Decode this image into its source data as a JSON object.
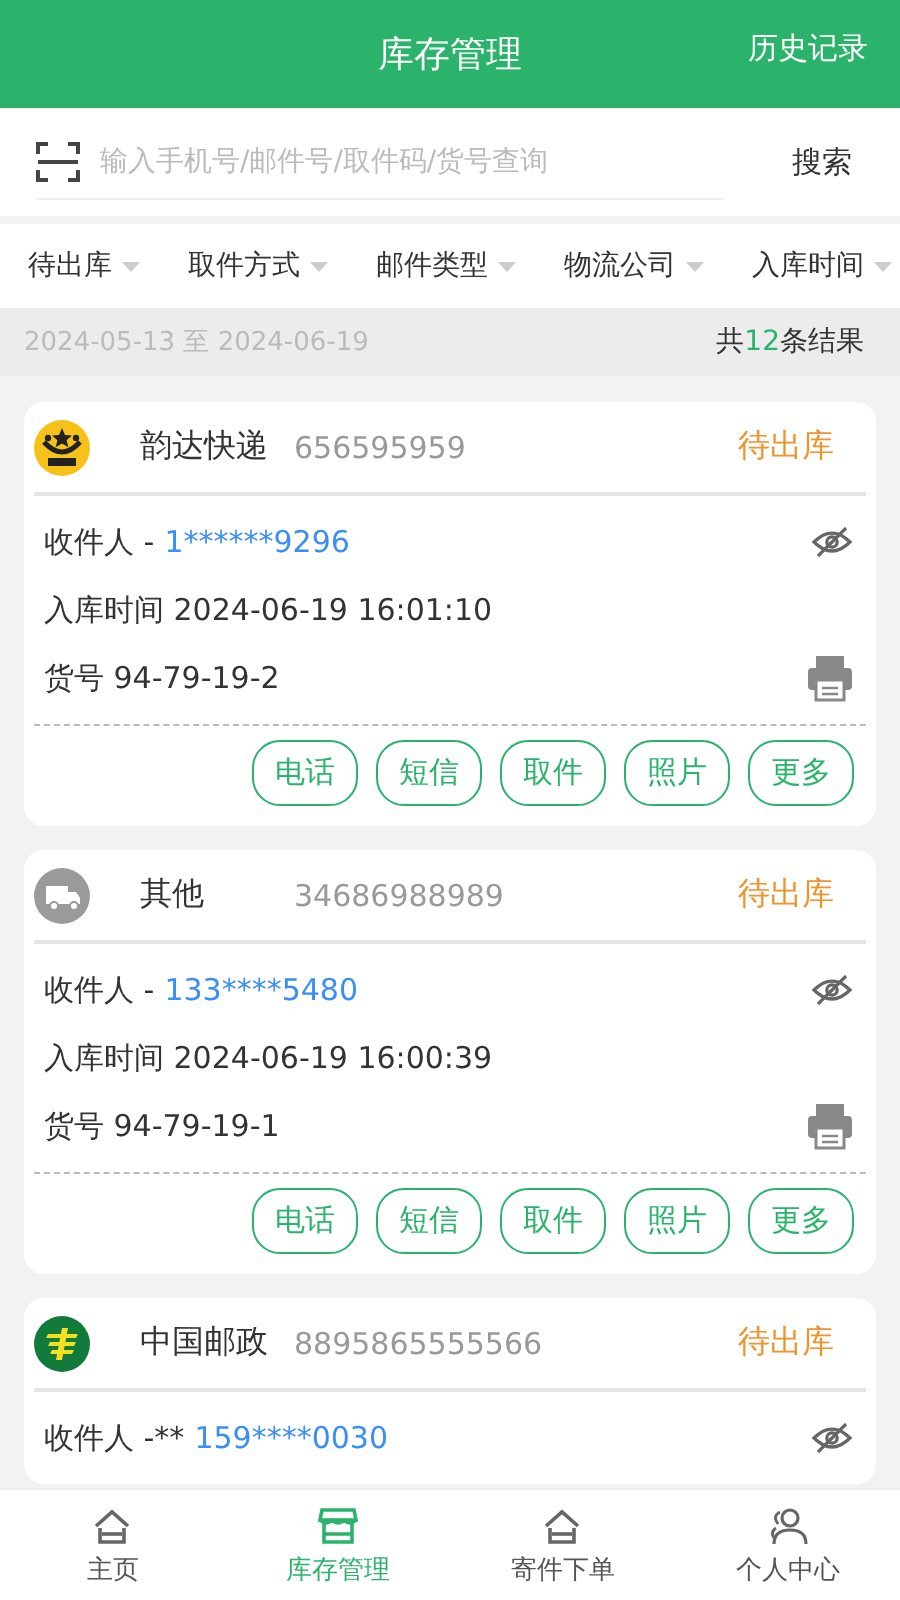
{
  "header": {
    "title": "库存管理",
    "action": "历史记录"
  },
  "search": {
    "placeholder": "输入手机号/邮件号/取件码/货号查询",
    "button": "搜索"
  },
  "filters": [
    {
      "label": "待出库"
    },
    {
      "label": "取件方式"
    },
    {
      "label": "邮件类型"
    },
    {
      "label": "物流公司"
    },
    {
      "label": "入库时间"
    }
  ],
  "summary": {
    "date_range": "2024-05-13 至 2024-06-19",
    "count_prefix": "共",
    "count": "12",
    "count_suffix": "条结果"
  },
  "parcels": [
    {
      "carrier": "韵达快递",
      "tracking_no": "656595959",
      "status": "待出库",
      "recipient_label": "收件人 -",
      "recipient_phone": "1******9296",
      "time": "入库时间 2024-06-19 16:01:10",
      "shelf_no": "货号 94-79-19-2",
      "actions": [
        "电话",
        "短信",
        "取件",
        "照片",
        "更多"
      ]
    },
    {
      "carrier": "其他",
      "tracking_no": "34686988989",
      "status": "待出库",
      "recipient_label": "收件人 -",
      "recipient_phone": "133****5480",
      "time": "入库时间 2024-06-19 16:00:39",
      "shelf_no": "货号 94-79-19-1",
      "actions": [
        "电话",
        "短信",
        "取件",
        "照片",
        "更多"
      ]
    },
    {
      "carrier": "中国邮政",
      "tracking_no": "8895865555566",
      "status": "待出库",
      "recipient_label": "收件人 -**",
      "recipient_phone": "159****0030"
    }
  ],
  "tabbar": [
    {
      "label": "主页",
      "selected": false
    },
    {
      "label": "库存管理",
      "selected": true
    },
    {
      "label": "寄件下单",
      "selected": false
    },
    {
      "label": "个人中心",
      "selected": false
    }
  ]
}
